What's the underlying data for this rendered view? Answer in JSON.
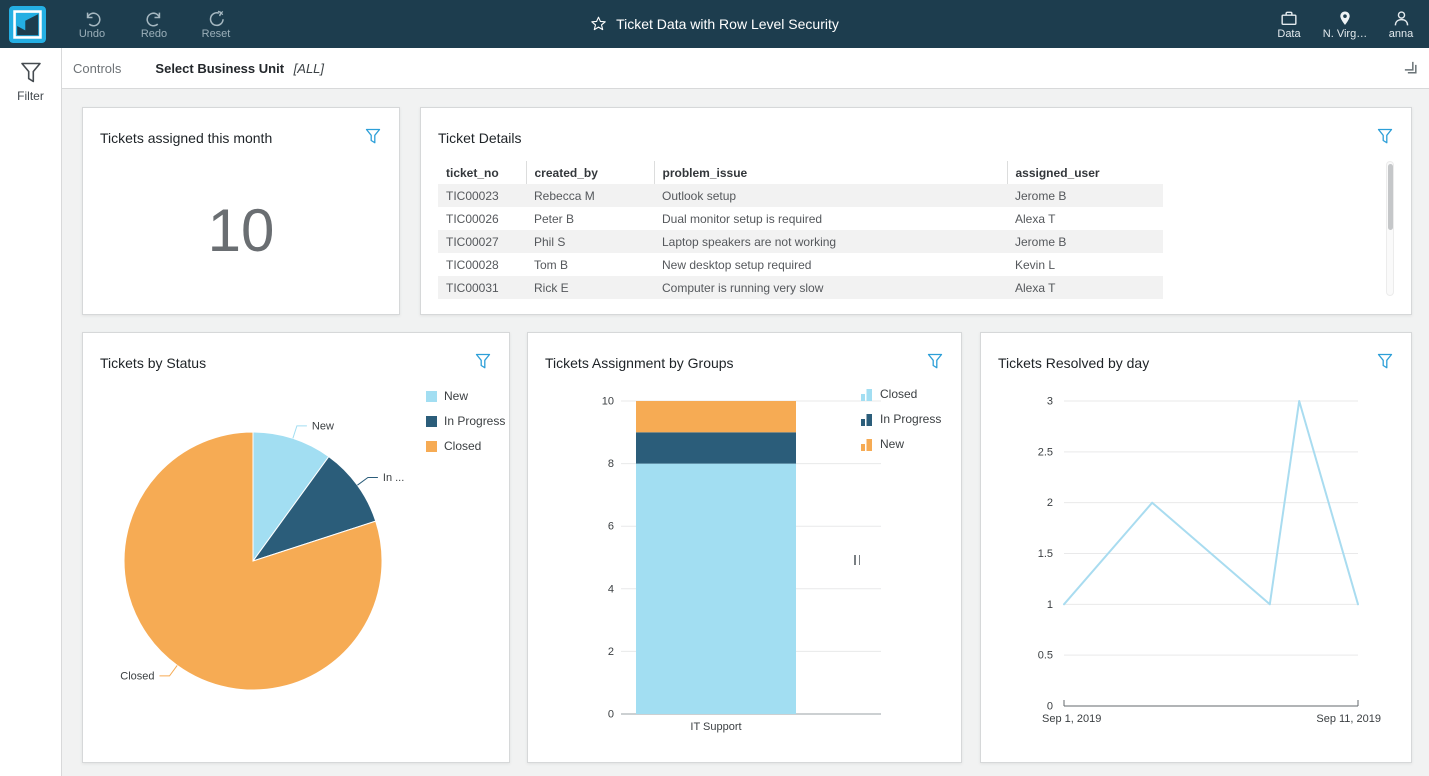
{
  "top_bar": {
    "undo": "Undo",
    "redo": "Redo",
    "reset": "Reset",
    "title": "Ticket Data with Row Level Security",
    "data": "Data",
    "region": "N. Virg…",
    "user": "anna"
  },
  "controls_bar": {
    "label": "Controls",
    "control_name": "Select Business Unit",
    "control_value": "[ALL]"
  },
  "sidebar": {
    "filter": "Filter"
  },
  "kpi": {
    "title": "Tickets assigned this month",
    "value": "10"
  },
  "table": {
    "title": "Ticket Details",
    "columns": [
      "ticket_no",
      "created_by",
      "problem_issue",
      "assigned_user"
    ],
    "rows": [
      [
        "TIC00023",
        "Rebecca M",
        "Outlook setup",
        "Jerome B"
      ],
      [
        "TIC00026",
        "Peter B",
        "Dual monitor setup is required",
        "Alexa T"
      ],
      [
        "TIC00027",
        "Phil S",
        "Laptop speakers are not working",
        "Jerome B"
      ],
      [
        "TIC00028",
        "Tom B",
        "New desktop setup required",
        "Kevin L"
      ],
      [
        "TIC00031",
        "Rick E",
        "Computer is running very slow",
        "Alexa T"
      ]
    ]
  },
  "colors": {
    "accent_blue": "#2d9fd8",
    "light_blue": "#a2def2",
    "dark_blue": "#2b5d7a",
    "orange": "#f6ab54",
    "top_bar_bg": "#1d3d4e"
  },
  "chart_data": [
    {
      "type": "pie",
      "title": "Tickets by Status",
      "labels": [
        "New",
        "In Progress",
        "Closed"
      ],
      "values": [
        1,
        1,
        8
      ],
      "colors": [
        "#a2def2",
        "#2b5d7a",
        "#f6ab54"
      ],
      "callout_labels": [
        "New",
        "In ...",
        "Closed"
      ],
      "legend_position": "right"
    },
    {
      "type": "bar",
      "stacked": true,
      "title": "Tickets Assignment by Groups",
      "categories": [
        "IT Support"
      ],
      "series": [
        {
          "name": "Closed",
          "values": [
            8
          ],
          "color": "#a2def2"
        },
        {
          "name": "In Progress",
          "values": [
            1
          ],
          "color": "#2b5d7a"
        },
        {
          "name": "New",
          "values": [
            1
          ],
          "color": "#f6ab54"
        }
      ],
      "ylim": [
        0,
        10
      ],
      "yticks": [
        0,
        2,
        4,
        6,
        8,
        10
      ],
      "grid": true,
      "legend_position": "right"
    },
    {
      "type": "line",
      "title": "Tickets Resolved by day",
      "x": [
        "Sep 1, 2019",
        "Sep 4, 2019",
        "Sep 8, 2019",
        "Sep 9, 2019",
        "Sep 11, 2019"
      ],
      "x_days": [
        1,
        4,
        8,
        9,
        11
      ],
      "values": [
        1,
        2,
        1,
        3,
        1
      ],
      "ylim": [
        0,
        3
      ],
      "yticks": [
        0,
        0.5,
        1,
        1.5,
        2,
        2.5,
        3
      ],
      "xlim_days": [
        1,
        11
      ],
      "x_axis_labels": [
        "Sep 1, 2019",
        "Sep 11, 2019"
      ],
      "color": "#a9dcf0",
      "grid": true,
      "legend_position": "none"
    }
  ]
}
